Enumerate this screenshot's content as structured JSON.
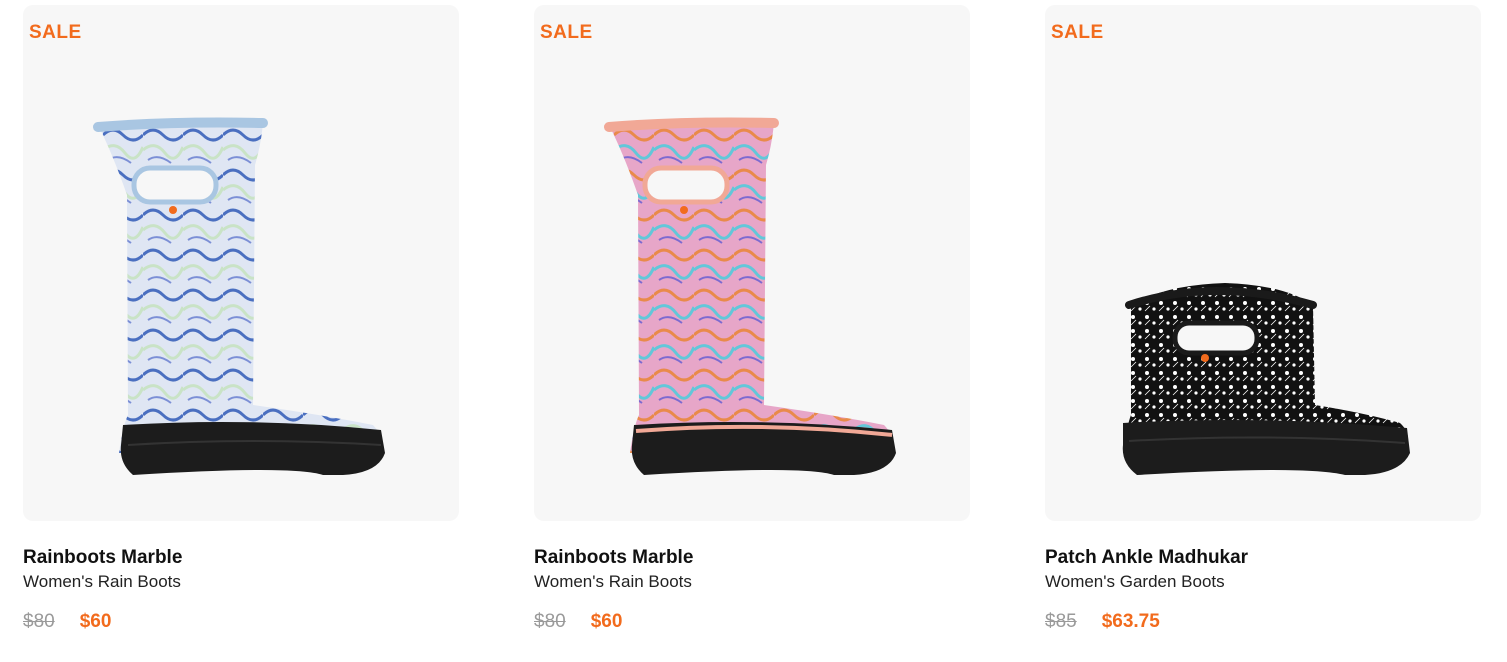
{
  "products": [
    {
      "badge": "SALE",
      "name": "Rainboots Marble",
      "category": "Women's Rain Boots",
      "original_price": "$80",
      "sale_price": "$60",
      "image": "tall-rain-boot-image",
      "colors": {
        "trim": "#a9c6e2",
        "pattern_a": "#4a6fc0",
        "pattern_b": "#c9e3c6",
        "pattern_c": "#dfe6f3"
      }
    },
    {
      "badge": "SALE",
      "name": "Rainboots Marble",
      "category": "Women's Rain Boots",
      "original_price": "$80",
      "sale_price": "$60",
      "image": "tall-rain-boot-image",
      "colors": {
        "trim": "#f1a896",
        "pattern_a": "#e98a4a",
        "pattern_b": "#62c7d9",
        "pattern_c": "#e7a6c8"
      }
    },
    {
      "badge": "SALE",
      "name": "Patch Ankle Madhukar",
      "category": "Women's Garden Boots",
      "original_price": "$85",
      "sale_price": "$63.75",
      "image": "ankle-garden-boot-image",
      "colors": {
        "trim": "#1a1a1a",
        "pattern_a": "#111111",
        "pattern_b": "#ffffff",
        "pattern_c": "#222222"
      }
    }
  ],
  "colors": {
    "accent": "#f26b1d",
    "card_bg": "#f7f7f7",
    "strike_price": "#9a9a9a"
  }
}
